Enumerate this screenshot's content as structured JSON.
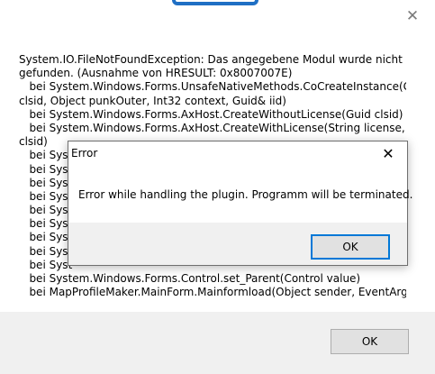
{
  "main_window": {
    "close_glyph": "✕",
    "error_lines": [
      "System.IO.FileNotFoundException: Das angegebene Modul wurde nicht",
      "gefunden. (Ausnahme von HRESULT: 0x8007007E)",
      "   bei System.Windows.Forms.UnsafeNativeMethods.CoCreateInstance(Guid&",
      "clsid, Object punkOuter, Int32 context, Guid& iid)",
      "   bei System.Windows.Forms.AxHost.CreateWithoutLicense(Guid clsid)",
      "   bei System.Windows.Forms.AxHost.CreateWithLicense(String license, Guid",
      "clsid)",
      "   bei Syst",
      "   bei Syst",
      "   bei Syst",
      "   bei Syst",
      "   bei Syst",
      "   bei Syst",
      "   bei Syst",
      "   bei Syst",
      "   bei Syst",
      "   bei System.Windows.Forms.Control.set_Parent(Control value)",
      "   bei MapProfileMaker.MainForm.Mainformload(Object sender, EventArgs e)"
    ],
    "ok_label": "OK"
  },
  "dialog": {
    "title": "Error",
    "close_glyph": "✕",
    "message": "Error while handling the plugin. Programm will be terminated.",
    "ok_label": "OK"
  },
  "colors": {
    "accent": "#0078d7",
    "tab_blue": "#1f6fc4",
    "footer_bg": "#f0f0f0",
    "button_bg": "#e1e1e1"
  }
}
